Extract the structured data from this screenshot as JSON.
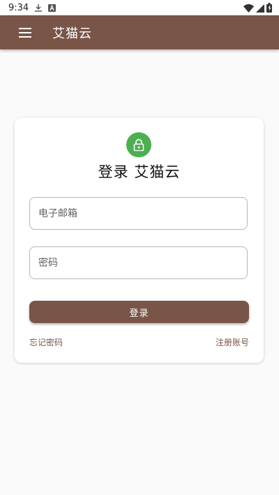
{
  "status_bar": {
    "time": "9:34",
    "icons": [
      "download-icon",
      "a-icon",
      "wifi-icon",
      "signal-icon",
      "battery-icon"
    ]
  },
  "app_bar": {
    "title": "艾猫云",
    "menu_icon": "hamburger-menu-icon"
  },
  "login_card": {
    "icon": "lock-icon",
    "title": "登录 艾猫云",
    "email_placeholder": "电子邮箱",
    "password_placeholder": "密码",
    "login_button": "登录",
    "forgot_password": "忘记密码",
    "register": "注册账号"
  },
  "colors": {
    "primary": "#795548",
    "lock_badge": "#4caf50",
    "background": "#fafafa"
  }
}
